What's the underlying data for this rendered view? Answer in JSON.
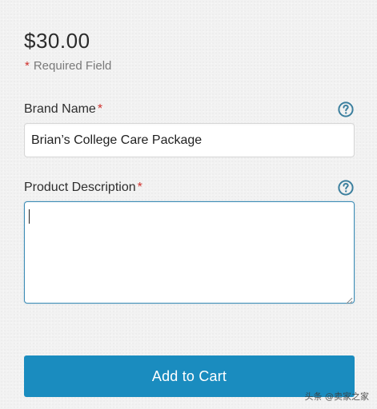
{
  "product": {
    "price": "$30.00"
  },
  "required_note": {
    "asterisk": "*",
    "text": "Required Field"
  },
  "fields": {
    "brand_name": {
      "label": "Brand Name",
      "required_mark": "*",
      "value": "Brian’s College Care Package",
      "help_icon": "question-circle-icon"
    },
    "product_description": {
      "label": "Product Description",
      "required_mark": "*",
      "value": "",
      "help_icon": "question-circle-icon"
    }
  },
  "actions": {
    "add_to_cart_label": "Add to Cart"
  },
  "watermark": {
    "text": "头条 @卖家之家"
  },
  "colors": {
    "accent": "#1a8cbf",
    "required": "#d0312d",
    "help_icon": "#3b7f9e",
    "focus_border": "#3b8bb5",
    "background": "#f2f2f2"
  }
}
